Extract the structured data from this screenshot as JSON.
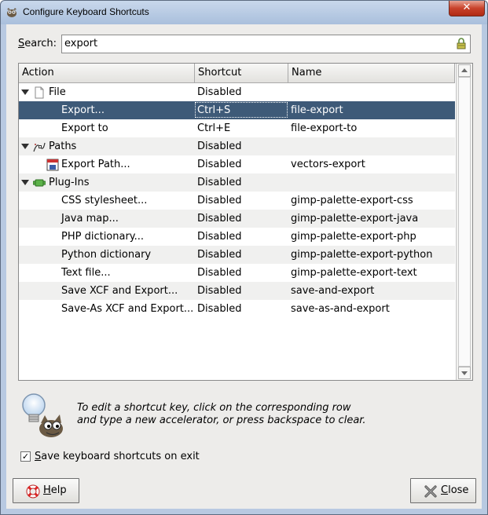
{
  "window": {
    "title": "Configure Keyboard Shortcuts",
    "close_glyph": "✕"
  },
  "search": {
    "label_mnemonic": "S",
    "label_rest": "earch:",
    "value": "export",
    "clear_icon": "clear-icon"
  },
  "table": {
    "columns": [
      "Action",
      "Shortcut",
      "Name"
    ],
    "rows": [
      {
        "type": "category",
        "icon": "document-icon",
        "action": "File",
        "shortcut": "Disabled",
        "name": ""
      },
      {
        "type": "item",
        "icon": "",
        "action": "Export...",
        "shortcut": "Ctrl+S",
        "name": "file-export",
        "selected": true
      },
      {
        "type": "item",
        "icon": "",
        "action": "Export to",
        "shortcut": "Ctrl+E",
        "name": "file-export-to"
      },
      {
        "type": "category",
        "icon": "paths-icon",
        "action": "Paths",
        "shortcut": "Disabled",
        "name": ""
      },
      {
        "type": "item",
        "icon": "export-path-icon",
        "action": "Export Path...",
        "shortcut": "Disabled",
        "name": "vectors-export"
      },
      {
        "type": "category",
        "icon": "plugin-icon",
        "action": "Plug-Ins",
        "shortcut": "Disabled",
        "name": ""
      },
      {
        "type": "item",
        "icon": "",
        "action": "CSS stylesheet...",
        "shortcut": "Disabled",
        "name": "gimp-palette-export-css"
      },
      {
        "type": "item",
        "icon": "",
        "action": "Java map...",
        "shortcut": "Disabled",
        "name": "gimp-palette-export-java"
      },
      {
        "type": "item",
        "icon": "",
        "action": "PHP dictionary...",
        "shortcut": "Disabled",
        "name": "gimp-palette-export-php"
      },
      {
        "type": "item",
        "icon": "",
        "action": "Python dictionary",
        "shortcut": "Disabled",
        "name": "gimp-palette-export-python"
      },
      {
        "type": "item",
        "icon": "",
        "action": "Text file...",
        "shortcut": "Disabled",
        "name": "gimp-palette-export-text"
      },
      {
        "type": "item",
        "icon": "",
        "action": "Save XCF and Export...",
        "shortcut": "Disabled",
        "name": "save-and-export"
      },
      {
        "type": "item",
        "icon": "",
        "action": "Save-As XCF and Export...",
        "shortcut": "Disabled",
        "name": "save-as-and-export"
      }
    ]
  },
  "hint": {
    "icon": "wilber-lightbulb-icon",
    "line1": "To edit a shortcut key, click on the corresponding row",
    "line2": "and type a new accelerator, or press backspace to clear."
  },
  "save_option": {
    "checked": true,
    "check_glyph": "✓",
    "label_mnemonic": "S",
    "label_rest": "ave keyboard shortcuts on exit"
  },
  "buttons": {
    "help": {
      "mnemonic": "H",
      "rest": "elp",
      "icon": "lifebuoy-icon"
    },
    "close": {
      "mnemonic": "C",
      "rest": "lose",
      "icon": "close-x-icon"
    }
  },
  "colors": {
    "selection": "#3e5a78",
    "titlebar": "#b8c9e1",
    "dialog_bg": "#edecea"
  }
}
